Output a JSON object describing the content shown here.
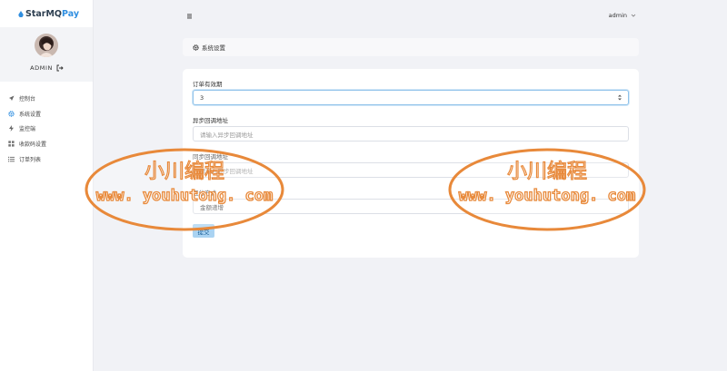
{
  "brand": {
    "prefix": "StarMQ",
    "suffix": "Pay"
  },
  "profile": {
    "username": "ADMIN"
  },
  "sidebar": {
    "items": [
      {
        "label": "控制台",
        "icon": "rocket-icon"
      },
      {
        "label": "系统设置",
        "icon": "gear-icon"
      },
      {
        "label": "监控端",
        "icon": "bolt-icon"
      },
      {
        "label": "收款码设置",
        "icon": "grid-icon"
      },
      {
        "label": "订单列表",
        "icon": "list-icon"
      }
    ]
  },
  "topbar": {
    "user": "admin"
  },
  "breadcrumb": {
    "title": "系统设置"
  },
  "form": {
    "order_validity_label": "订单有效期",
    "order_validity_value": "3",
    "async_callback_label": "异步回调地址",
    "async_callback_placeholder": "请输入异步回调地址",
    "sync_callback_label": "同步回调地址",
    "sync_callback_placeholder": "请输入同步回调地址",
    "amount_mode_label": "区分方式",
    "amount_mode_value": "金额递增",
    "submit_label": "提交"
  },
  "watermark": {
    "cn": "小川编程",
    "url": "www. youhutong. com"
  },
  "colors": {
    "accent": "#2f8ee0",
    "submit_bg": "#aad3f2",
    "watermark": "#e8893a"
  }
}
